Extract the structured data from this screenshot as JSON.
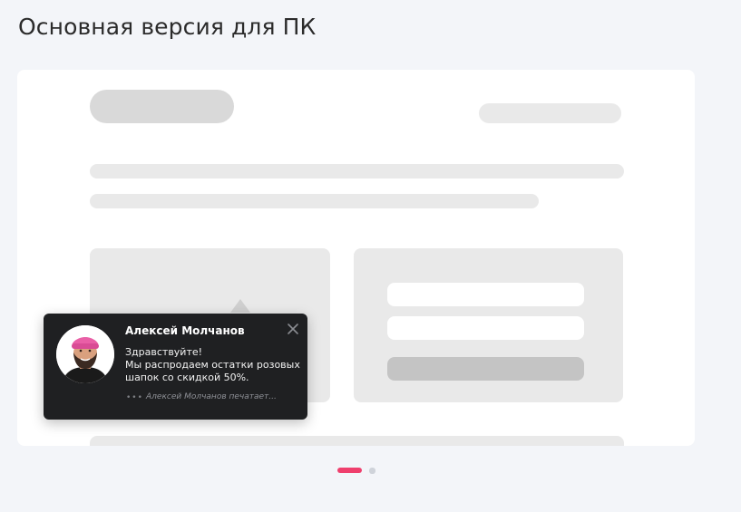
{
  "page": {
    "title": "Основная версия для ПК"
  },
  "chat": {
    "agent_name": "Алексей Молчанов",
    "message": "Здравствуйте!\nМы распродаем остатки розовых шапок со скидкой 50%.",
    "typing_dots": "•••",
    "typing_status": "Алексей Молчанов печатает...",
    "close_icon": "close-icon",
    "avatar_icon": "avatar-photo"
  },
  "pager": {
    "count": 2,
    "active_index": 0
  },
  "colors": {
    "background": "#f3f5f9",
    "card": "#ffffff",
    "placeholder": "#e9e9e9",
    "popup": "#1f2022",
    "accent": "#ef3f6d",
    "hat": "#e95fa6"
  }
}
